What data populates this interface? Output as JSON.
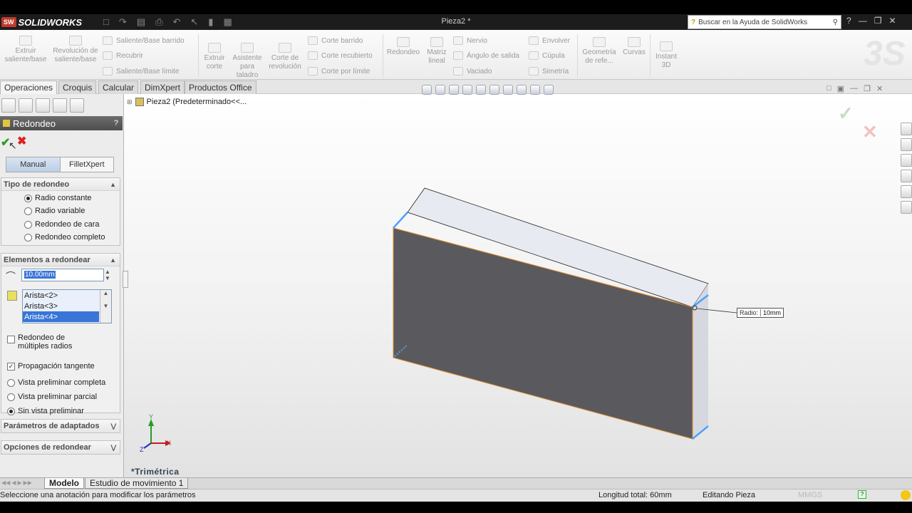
{
  "app": {
    "brand_prefix": "SW",
    "brand": "SOLIDWORKS",
    "document_title": "Pieza2 *",
    "help_search_placeholder": "Buscar en la Ayuda de SolidWorks"
  },
  "ribbon": {
    "extrude_boss": "Extruir saliente/base",
    "revolve_boss": "Revolución de saliente/base",
    "sweep_boss": "Saliente/Base barrido",
    "loft_boss": "Recubrir",
    "boundary_boss": "Saliente/Base límite",
    "extrude_cut": "Extruir corte",
    "hole_wizard": "Asistente para taladro",
    "revolve_cut": "Corte de revolución",
    "sweep_cut": "Corte barrido",
    "loft_cut": "Corte recubierto",
    "boundary_cut": "Corte por límite",
    "fillet": "Redondeo",
    "linear_pattern": "Matriz lineal",
    "rib": "Nervio",
    "draft": "Ángulo de salida",
    "shell": "Vaciado",
    "wrap": "Envolver",
    "dome": "Cúpula",
    "mirror": "Simetría",
    "ref_geometry": "Geometría de refe...",
    "curves": "Curvas",
    "instant3d": "Instant 3D"
  },
  "cm_tabs": [
    "Operaciones",
    "Croquis",
    "Calcular",
    "DimXpert",
    "Productos Office"
  ],
  "tree": {
    "root": "Pieza2  (Predeterminado<<..."
  },
  "pm": {
    "title": "Redondeo",
    "help": "?",
    "tab_manual": "Manual",
    "tab_filletxpert": "FilletXpert",
    "type_group": "Tipo de redondeo",
    "type_options": [
      "Radio constante",
      "Radio variable",
      "Redondeo de cara",
      "Redondeo completo"
    ],
    "items_group": "Elementos a redondear",
    "radius_value": "10.00mm",
    "edges": [
      "Arista<2>",
      "Arista<3>",
      "Arista<4>"
    ],
    "multi_radius": "Redondeo de múltiples radios",
    "tangent_propagation": "Propagación tangente",
    "preview_options": [
      "Vista preliminar completa",
      "Vista preliminar parcial",
      "Sin vista preliminar"
    ],
    "setback_group": "Parámetros de adaptados",
    "fillet_options_group": "Opciones de redondear"
  },
  "viewport": {
    "view_label": "*Trimétrica",
    "radius_tag_key": "Radio:",
    "radius_tag_value": "10mm"
  },
  "model_tabs": [
    "Modelo",
    "Estudio de movimiento 1"
  ],
  "status": {
    "message": "Seleccione una anotación para modificar los parámetros",
    "total_length": "Longitud total: 60mm",
    "mode": "Editando Pieza",
    "units": "MMGS"
  },
  "colors": {
    "face": "#5a5a5e",
    "edge_highlight": "#4aa3ff",
    "edge_orange": "#e08a2a"
  }
}
